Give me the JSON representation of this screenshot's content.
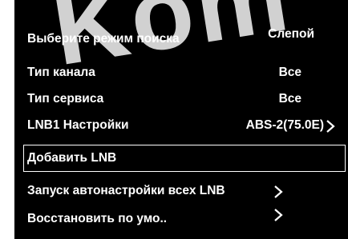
{
  "watermark": "Kom",
  "menu": {
    "search_mode": {
      "label": "Выберите режим поиска",
      "value": "Слепой"
    },
    "channel_type": {
      "label": "Тип канала",
      "value": "Все"
    },
    "service_type": {
      "label": "Тип сервиса",
      "value": "Все"
    },
    "lnb1_settings": {
      "label": "LNB1 Настройки",
      "value": "ABS-2(75.0E)"
    },
    "add_lnb": {
      "label": "Добавить LNB"
    },
    "autoscan_all": {
      "label": "Запуск автонастройки всех LNB"
    },
    "restore_defaults": {
      "label": "Восстановить по умо.."
    }
  },
  "selected_item": "add_lnb",
  "colors": {
    "background": "#000000",
    "text": "#ffffff",
    "highlight_border": "#ffffff"
  }
}
